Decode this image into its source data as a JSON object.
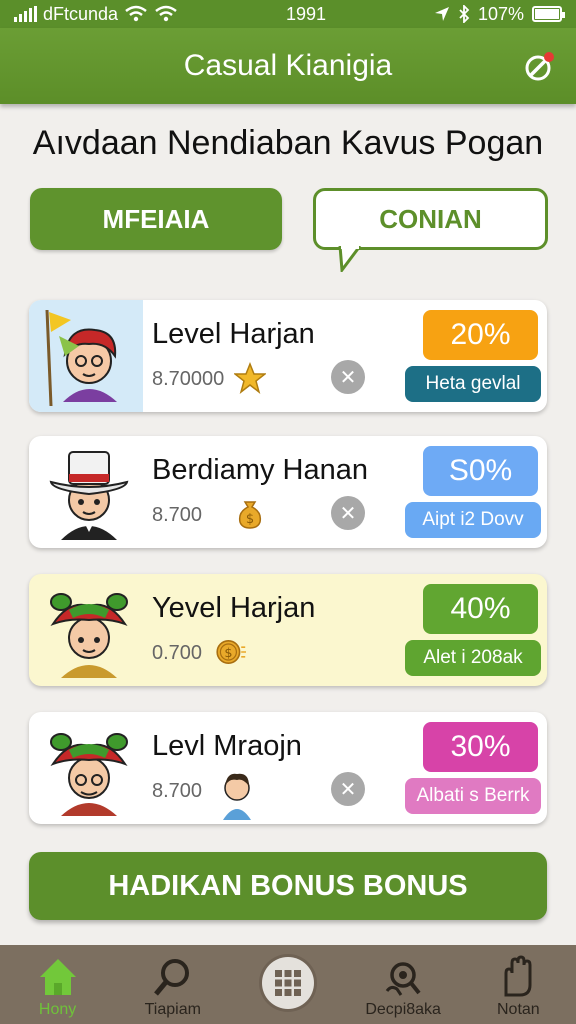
{
  "status_bar": {
    "carrier": "dFtcunda",
    "time": "1991",
    "battery": "107%"
  },
  "header": {
    "title": "Casual Kianigia",
    "action_icon": "hanger-edit-icon"
  },
  "page_title": "Aıvdaan Nendiaban Kavus Pogan",
  "tabs": [
    {
      "label": "MFEIAIA",
      "active": true
    },
    {
      "label": "CONIAN",
      "active": false
    }
  ],
  "cards": [
    {
      "name": "Level Harjan",
      "value": "8.70000",
      "icon": "star-icon",
      "percent": "20%",
      "action": "Heta gevlal",
      "percent_color": "#f7a212",
      "action_color": "#1d6f86",
      "highlighted": false
    },
    {
      "name": "Berdiamy Hanan",
      "value": "8.700",
      "icon": "money-bag-icon",
      "percent": "S0%",
      "action": "Aipt i2 Dovv",
      "percent_color": "#6eaaf5",
      "action_color": "#69a9f3",
      "highlighted": false
    },
    {
      "name": "Yevel Harjan",
      "value": "0.700",
      "icon": "coin-icon",
      "percent": "40%",
      "action": "Alet i 208ak",
      "percent_color": "#61a631",
      "action_color": "#5fa530",
      "highlighted": true
    },
    {
      "name": "Levl Mraojn",
      "value": "8.700",
      "icon": "person-icon",
      "percent": "30%",
      "action": "Albati s Berrk",
      "percent_color": "#d743a8",
      "action_color": "#e07ac2",
      "highlighted": false
    }
  ],
  "bonus_button": "HADIKAN BONUS BONUS",
  "nav": [
    {
      "label": "Hony",
      "icon": "home-icon",
      "active": true
    },
    {
      "label": "Tiapiam",
      "icon": "search-icon",
      "active": false
    },
    {
      "label": "",
      "icon": "grid-icon",
      "active": false
    },
    {
      "label": "Decpi8aka",
      "icon": "search-hand-icon",
      "active": false
    },
    {
      "label": "Notan",
      "icon": "hand-icon",
      "active": false
    }
  ]
}
